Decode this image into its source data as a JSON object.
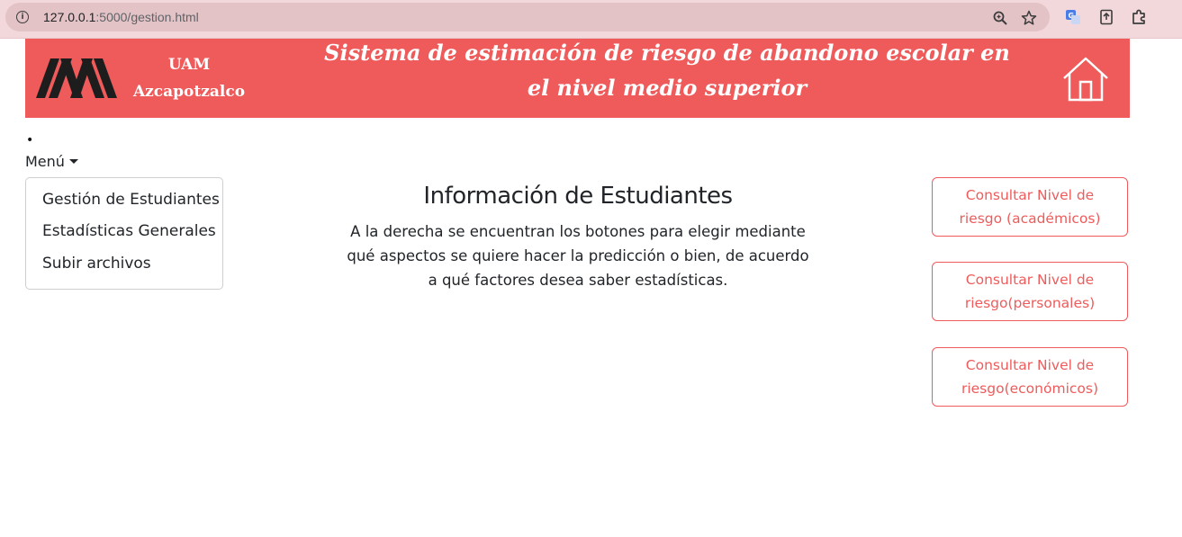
{
  "browser": {
    "url_host": "127.0.0.1",
    "url_path": ":5000/gestion.html"
  },
  "header": {
    "org_line1": "UAM",
    "org_line2": "Azcapotzalco",
    "title": "Sistema de estimación de riesgo de abandono escolar en el nivel medio superior"
  },
  "nav": {
    "bullet": "•",
    "menu_label": "Menú",
    "items": [
      {
        "label": "Gestión de Estudiantes"
      },
      {
        "label": "Estadísticas Generales"
      },
      {
        "label": "Subir archivos"
      }
    ]
  },
  "main": {
    "title": "Información de Estudiantes",
    "description": "A la derecha se encuentran los botones para elegir mediante qué aspectos se quiere hacer la predicción o bien, de acuerdo a qué factores desea saber estadísticas."
  },
  "actions": [
    {
      "label": "Consultar Nivel de riesgo (académicos)"
    },
    {
      "label": "Consultar Nivel de riesgo(personales)"
    },
    {
      "label": "Consultar Nivel de riesgo(económicos)"
    }
  ],
  "colors": {
    "accent": "#ef5b5b",
    "browser_bar": "#f2d8da"
  },
  "icons": [
    "info-icon",
    "zoom-icon",
    "star-icon",
    "translate-icon",
    "extension-upload-icon",
    "puzzle-icon",
    "uam-logo",
    "home-icon"
  ]
}
